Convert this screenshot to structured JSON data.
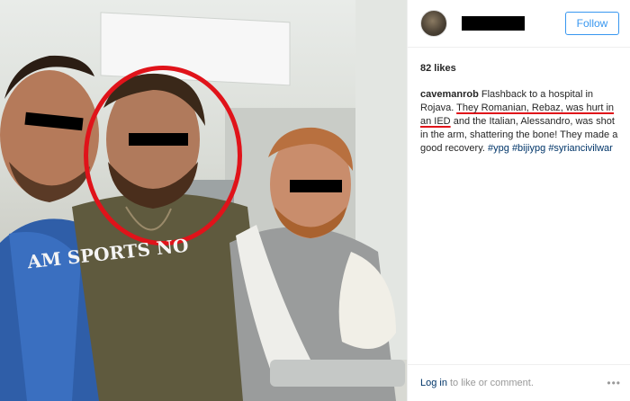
{
  "post": {
    "shirt_text": "AM\nSPORTS NO"
  },
  "header": {
    "follow_label": "Follow"
  },
  "likes": "82 likes",
  "caption": {
    "username": "cavemanrob",
    "text_1": "Flashback to a hospital in Rojava.",
    "text_highlight": "They Romanian, Rebaz, was hurt in an IED",
    "text_2": "and the Italian, Alessandro, was shot in the arm, shattering the bone! They made a good recovery.",
    "hashtags": [
      "#ypg",
      "#bijiypg",
      "#syriancivilwar"
    ]
  },
  "footer": {
    "login_label": "Log in",
    "rest_label": "to like or comment.",
    "more_icon": "more-options-icon"
  },
  "colors": {
    "follow_blue": "#3897f0",
    "annotation_red": "#e0131a",
    "link_navy": "#003569"
  }
}
